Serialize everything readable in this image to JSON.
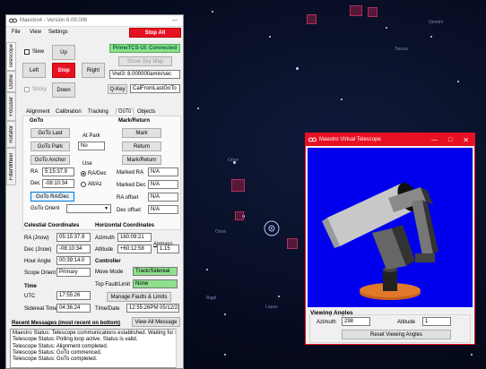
{
  "sky": {
    "labels": [
      "Taurus",
      "Orion",
      "Lepus",
      "Orion",
      "Rigel",
      "Gemini"
    ]
  },
  "maestro": {
    "title": "Maestro4 - Version 6.09.006",
    "menu": [
      "File",
      "View",
      "Settings"
    ],
    "stop_all": "Stop All",
    "side_tabs": [
      "Telescope",
      "Dome",
      "Focuser",
      "Rotator",
      "FilterWheel"
    ],
    "slew": {
      "slew_label": "Slew",
      "up": "Up",
      "left": "Left",
      "stop": "Stop",
      "right": "Right",
      "down": "Down",
      "sticky_label": "Sticky"
    },
    "connection_status": "PrimeTCS-Ui: Connected",
    "show_sky_map": "Show Sky Map",
    "vrel_select": "Vrel3: 8.000000amin/sec",
    "qkey_button": "Q-Key",
    "qkey_select": "CalFromLastGoTo",
    "tabs": [
      "Alignment",
      "Calibration",
      "Tracking",
      "GoTo",
      "Objects"
    ],
    "goto": {
      "group_title": "GoTo",
      "goto_last": "GoTo Last",
      "goto_park": "GoTo Park",
      "goto_anchor": "GoTo Anchor",
      "at_park_label": "At Park",
      "at_park_value": "No",
      "ra_label": "RA",
      "ra_value": "5:15:37.9",
      "dec_label": "Dec",
      "dec_value": "-08:10:34",
      "use_label": "Use",
      "use_options": [
        "RA/Dec",
        "Alt/Az"
      ],
      "goto_radec": "GoTo RA/Dec",
      "goto_orient_label": "GoTo Orient"
    },
    "mark": {
      "group_title": "Mark/Return",
      "mark": "Mark",
      "return": "Return",
      "mark_return": "Mark/Return",
      "marked_ra_label": "Marked RA",
      "marked_ra_value": "N/A",
      "marked_dec_label": "Marked Dec",
      "marked_dec_value": "N/A",
      "ra_offset_label": "RA offset",
      "ra_offset_value": "N/A",
      "dec_offset_label": "Dec offset",
      "dec_offset_value": "N/A"
    },
    "celestial": {
      "title": "Celestial Coordinates",
      "ra_label": "RA (Jnow)",
      "ra_value": "05:15:37.9",
      "dec_label": "Dec (Jnow)",
      "dec_value": "-08:10:34",
      "hour_angle_label": "Hour Angle",
      "hour_angle_value": "00:39:14.0",
      "scope_orient_label": "Scope Orient",
      "scope_orient_value": "Primary"
    },
    "time": {
      "title": "Time",
      "utc_label": "UTC",
      "utc_value": "17:55:26",
      "sidereal_label": "Sidereal Time",
      "sidereal_value": "04:36:24",
      "datetime_label": "Time/Date",
      "datetime_value": "12:55:26PM  05/12/23"
    },
    "horizontal": {
      "title": "Horizontal Coordinates",
      "azimuth_label": "Azimuth",
      "azimuth_value": "160:09:21",
      "altitude_label": "Altitude",
      "altitude_value": "+60:12:58",
      "airmass_label": "Airmass",
      "airmass_value": "1.15"
    },
    "controller": {
      "title": "Controller",
      "move_mode_label": "Move Mode",
      "move_mode_value": "Track/Sidereal",
      "top_fault_label": "Top Fault/Limit",
      "top_fault_value": "None",
      "manage_faults": "Manage Faults & Limits"
    },
    "messages": {
      "title": "Recent Messages (most recent on bottom)",
      "view_all": "View All Message",
      "lines": [
        "Maestro Status: Telescope communications established.  Waiting for status u",
        "Telescope Status: Polling loop active.  Status is valid.",
        "Telescope Status: Alignment completed.",
        "Telescope Status: GoTo commenced.",
        "Telescope Status: GoTo completed."
      ]
    }
  },
  "virtual_telescope": {
    "title": "Maestro Virtual Telescope",
    "viewing_angles_title": "Viewing Angles",
    "azimuth_label": "Azimuth",
    "azimuth_value": "298",
    "altitude_label": "Altitude",
    "altitude_value": "1",
    "reset_button": "Reset Viewing Angles"
  },
  "colors": {
    "stop_red": "#e81123",
    "status_green": "#8ee08e",
    "accent_blue": "#0078d7"
  }
}
